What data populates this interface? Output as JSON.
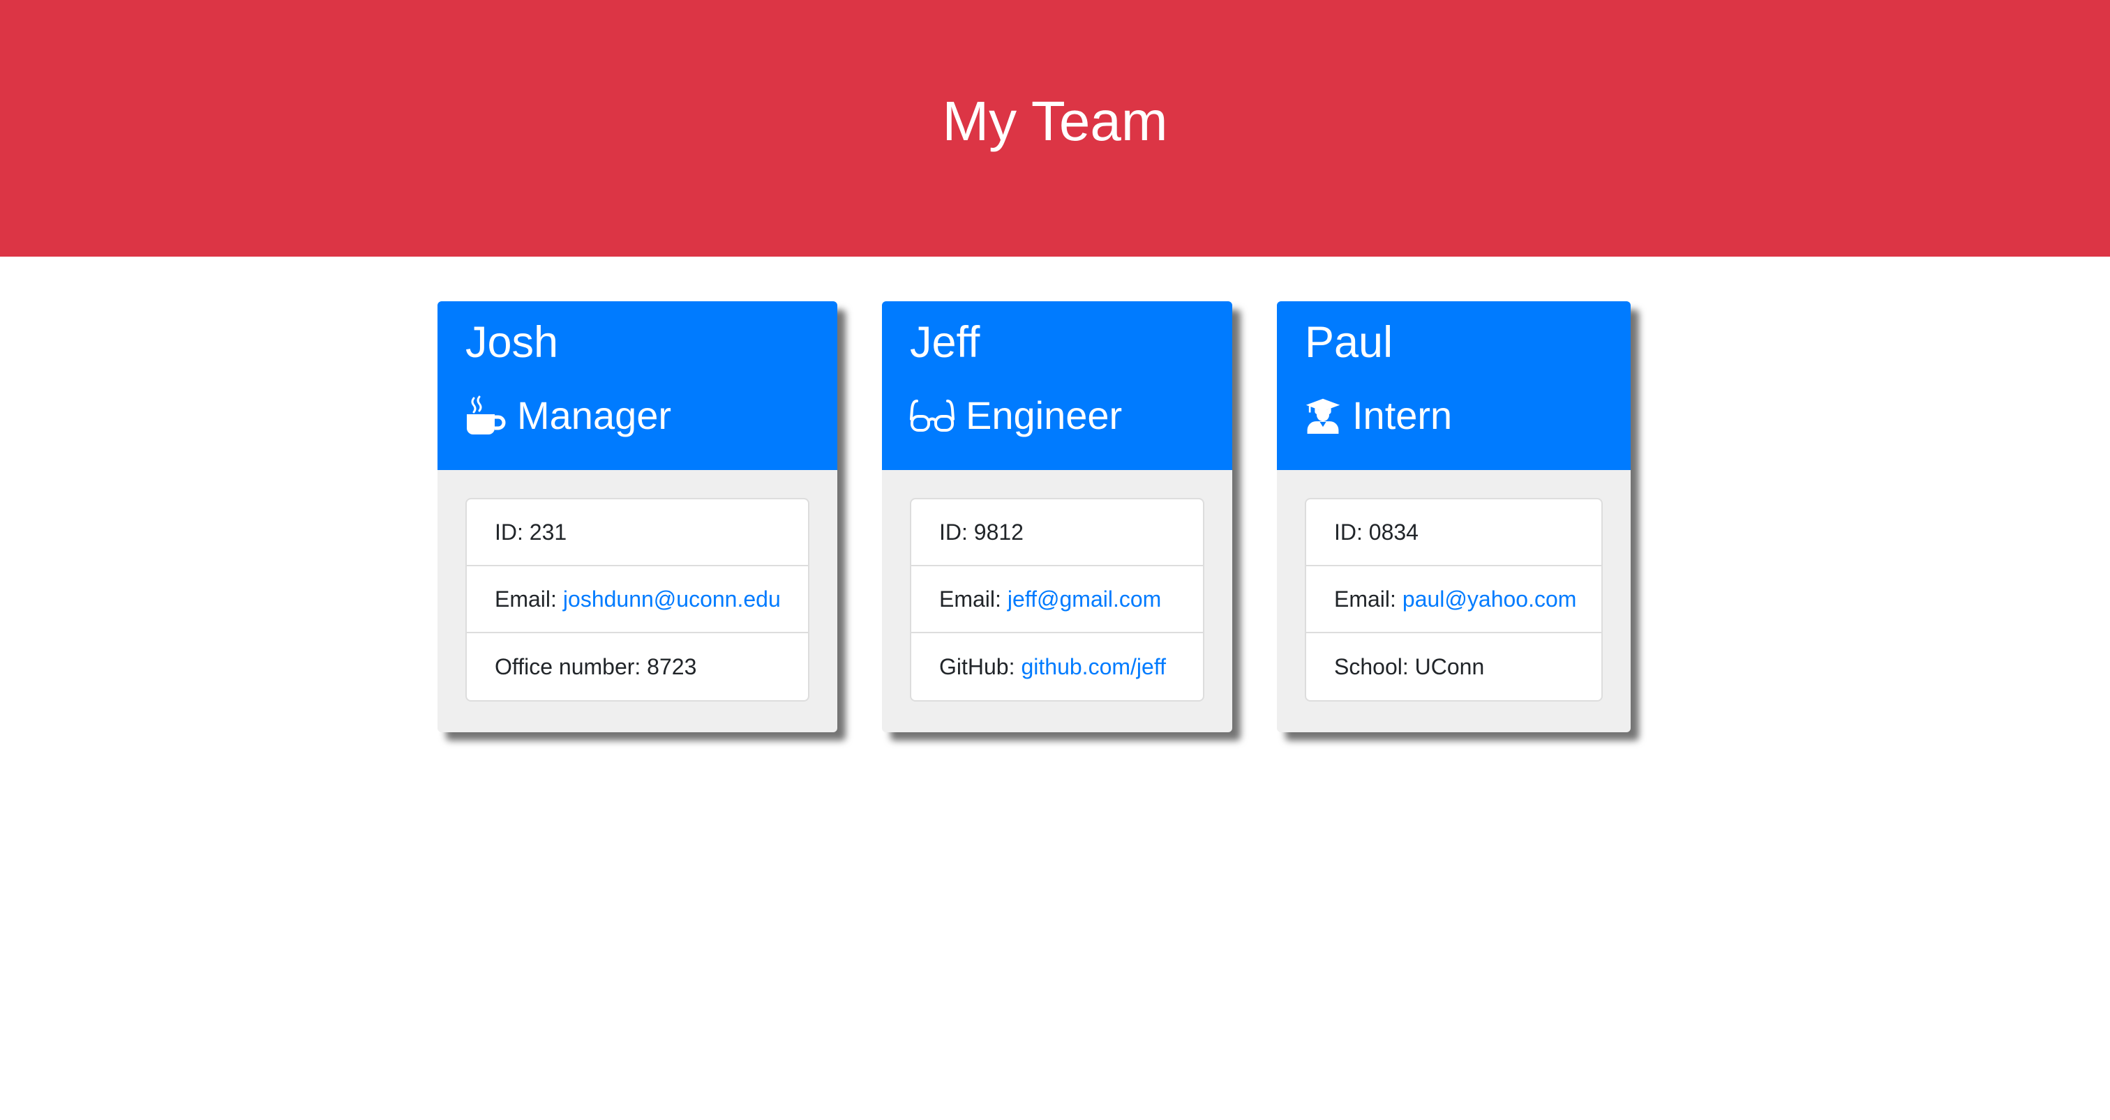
{
  "header": {
    "title": "My Team"
  },
  "colors": {
    "header_bg": "#dc3545",
    "card_head_bg": "#007bff",
    "link": "#007bff",
    "card_bg": "#efefef"
  },
  "cards": [
    {
      "name": "Josh",
      "role": "Manager",
      "role_icon": "mug-hot-icon",
      "id_text": "ID: 231",
      "email_label": "Email:",
      "email": "joshdunn@uconn.edu",
      "extra_label": "Office number: 8723",
      "extra_link": ""
    },
    {
      "name": "Jeff",
      "role": "Engineer",
      "role_icon": "glasses-icon",
      "id_text": "ID: 9812",
      "email_label": "Email:",
      "email": "jeff@gmail.com",
      "extra_label": "GitHub:",
      "extra_link": "github.com/jeff"
    },
    {
      "name": "Paul",
      "role": "Intern",
      "role_icon": "user-graduate-icon",
      "id_text": "ID: 0834",
      "email_label": "Email:",
      "email": "paul@yahoo.com",
      "extra_label": "School: UConn",
      "extra_link": ""
    }
  ]
}
